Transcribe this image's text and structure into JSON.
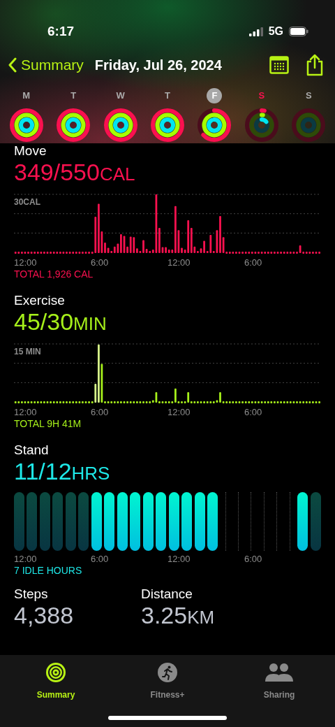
{
  "status_bar": {
    "time": "6:17",
    "network": "5G"
  },
  "nav": {
    "back": "Summary",
    "title": "Friday, Jul 26, 2024"
  },
  "days": [
    {
      "letter": "M",
      "selected": false,
      "today": false
    },
    {
      "letter": "T",
      "selected": false,
      "today": false
    },
    {
      "letter": "W",
      "selected": false,
      "today": false
    },
    {
      "letter": "T",
      "selected": false,
      "today": false
    },
    {
      "letter": "F",
      "selected": true,
      "today": false
    },
    {
      "letter": "S",
      "selected": false,
      "today": true
    },
    {
      "letter": "S",
      "selected": false,
      "today": false
    }
  ],
  "metrics": [
    {
      "kind": "move",
      "label": "Move",
      "value": "349/550",
      "unit": "CAL",
      "scale_label": "30CAL",
      "x_labels": [
        "12:00",
        "6:00",
        "12:00",
        "6:00"
      ],
      "footer": "TOTAL 1,926 CAL"
    },
    {
      "kind": "exercise",
      "label": "Exercise",
      "value": "45/30",
      "unit": "MIN",
      "scale_label": "15 MIN",
      "x_labels": [
        "12:00",
        "6:00",
        "12:00",
        "6:00"
      ],
      "footer": "TOTAL 9H 41M"
    },
    {
      "kind": "stand",
      "label": "Stand",
      "value": "11/12",
      "unit": "HRS",
      "x_labels": [
        "12:00",
        "6:00",
        "12:00",
        "6:00"
      ],
      "footer": "7 IDLE HOURS",
      "hours": [
        {
          "kind": "idle"
        },
        {
          "kind": "idle"
        },
        {
          "kind": "idle"
        },
        {
          "kind": "idle"
        },
        {
          "kind": "idle"
        },
        {
          "kind": "idle"
        },
        {
          "kind": "stood"
        },
        {
          "kind": "stood"
        },
        {
          "kind": "stood"
        },
        {
          "kind": "stood"
        },
        {
          "kind": "stood"
        },
        {
          "kind": "stood"
        },
        {
          "kind": "stood"
        },
        {
          "kind": "stood"
        },
        {
          "kind": "stood"
        },
        {
          "kind": "stood"
        },
        {
          "kind": "none"
        },
        {
          "kind": "none"
        },
        {
          "kind": "none"
        },
        {
          "kind": "none"
        },
        {
          "kind": "none"
        },
        {
          "kind": "none"
        },
        {
          "kind": "stood"
        },
        {
          "kind": "idle"
        }
      ]
    }
  ],
  "stats": [
    {
      "label": "Steps",
      "value": "4,388"
    },
    {
      "label": "Distance",
      "value": "3.25",
      "unit": "KM"
    }
  ],
  "tab_bar": [
    {
      "kind": "summary",
      "label": "Summary",
      "selected": true
    },
    {
      "kind": "fitness",
      "label": "Fitness+",
      "selected": false
    },
    {
      "kind": "sharing",
      "label": "Sharing",
      "selected": false
    }
  ]
}
